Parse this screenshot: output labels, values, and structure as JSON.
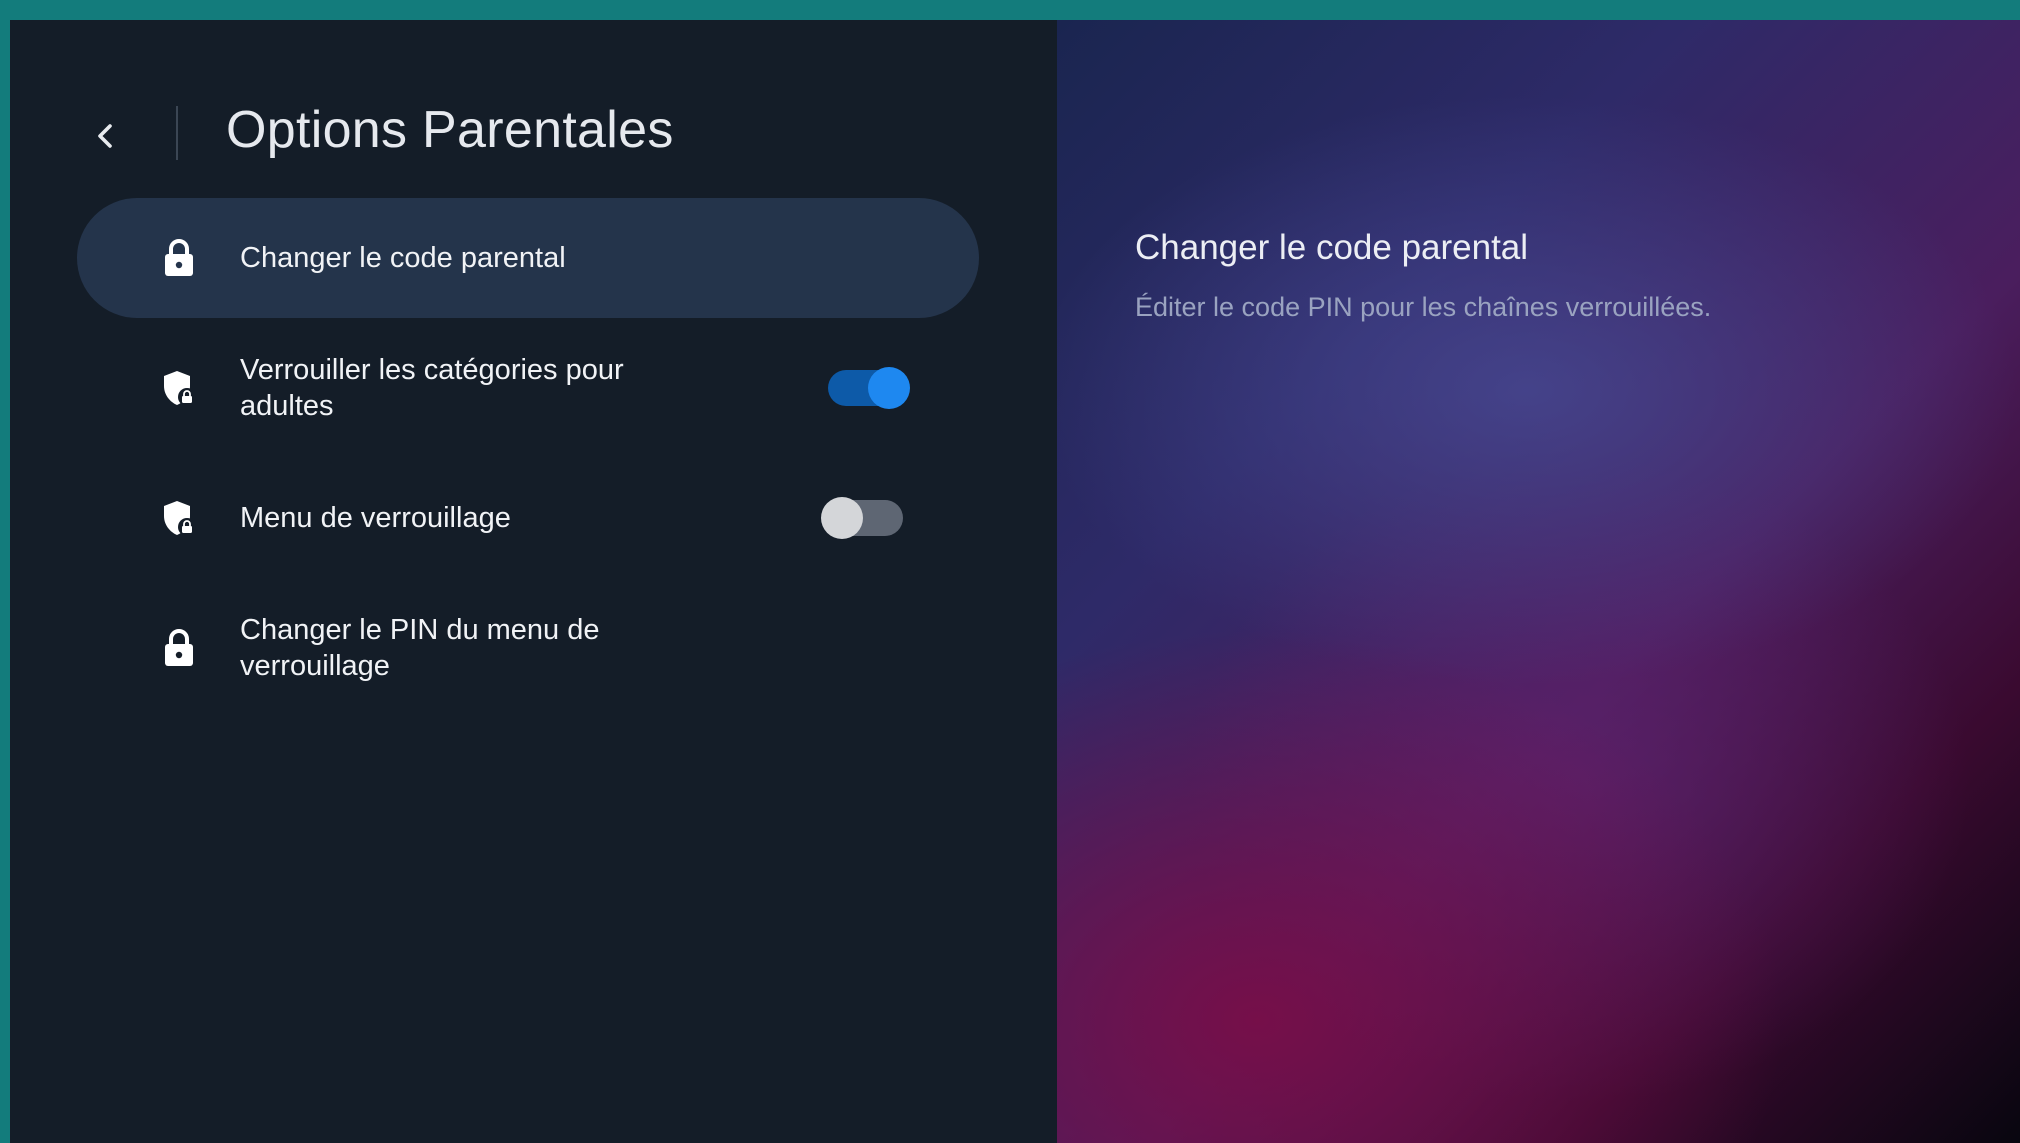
{
  "header": {
    "title": "Options Parentales",
    "back_icon": "chevron-left-icon"
  },
  "menu": {
    "items": [
      {
        "label": "Changer le code parental",
        "icon": "lock-icon",
        "selected": true
      },
      {
        "label": "Verrouiller les catégories pour adultes",
        "icon": "shield-lock-icon",
        "toggle": "on"
      },
      {
        "label": "Menu de verrouillage",
        "icon": "shield-lock-icon",
        "toggle": "off"
      },
      {
        "label": "Changer le PIN du menu de verrouillage",
        "icon": "lock-icon"
      }
    ]
  },
  "detail": {
    "title": "Changer le code parental",
    "description": "Éditer le code PIN pour les chaînes verrouillées."
  },
  "colors": {
    "frame": "#137c7c",
    "panel": "#141d28",
    "selected_item": "#24344b",
    "toggle_on": "#1e88f0"
  }
}
